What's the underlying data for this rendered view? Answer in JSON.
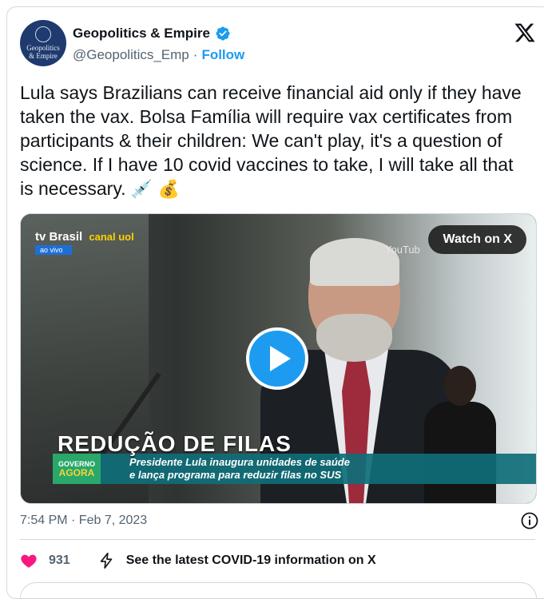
{
  "author": {
    "name": "Geopolitics & Empire",
    "handle": "@Geopolitics_Emp",
    "separator": "·",
    "follow_label": "Follow",
    "avatar_text_1": "Geopolitics",
    "avatar_text_2": "& Empire"
  },
  "tweet": {
    "text": "Lula says Brazilians can receive financial aid only if they have taken the vax. Bolsa Família will require vax certificates from participants & their children: We can't play, it's a question of science. If I have 10 covid vaccines to take, I will take all that is necessary.",
    "emoji_1": "💉",
    "emoji_2": "💰"
  },
  "media": {
    "watch_label": "Watch on X",
    "channel_logo": "tv Brasil",
    "uol_logo": "canal uol",
    "live_tag": "ao vivo",
    "youtube_text": "YouTub",
    "headline": "REDUÇÃO DE FILAS",
    "program_logo_1": "GOVERNO",
    "program_logo_2": "AGORA",
    "subhead_1": "Presidente Lula inaugura unidades de saúde",
    "subhead_2": "e lança programa para reduzir filas no SUS"
  },
  "meta": {
    "timestamp": "7:54 PM · Feb 7, 2023"
  },
  "actions": {
    "likes": "931",
    "covid_link": "See the latest COVID-19 information on X"
  },
  "colors": {
    "accent": "#1d9bf0",
    "heart": "#f91880",
    "muted": "#536471"
  }
}
